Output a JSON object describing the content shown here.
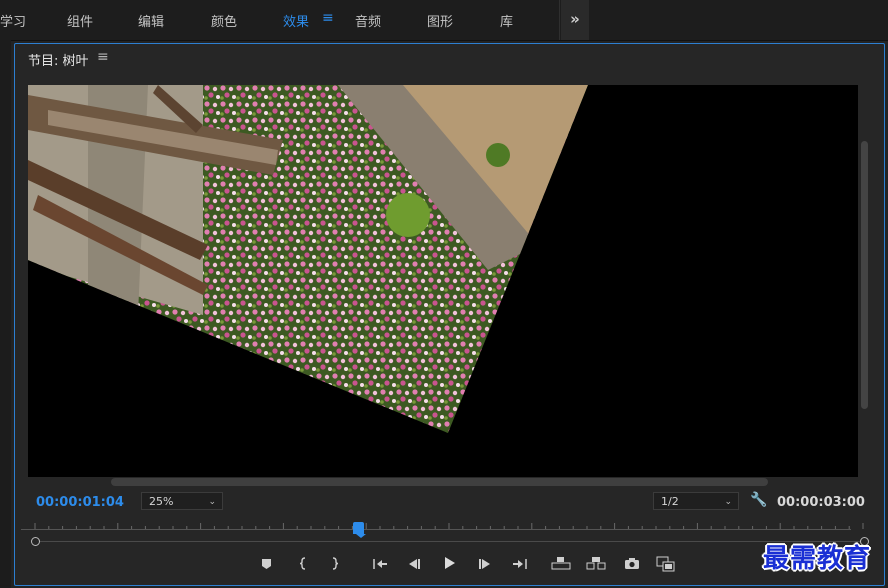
{
  "workspace_tabs": [
    "学习",
    "组件",
    "编辑",
    "颜色",
    "效果",
    "音频",
    "图形",
    "库"
  ],
  "active_tab": "效果",
  "panel": {
    "title": "节目: 树叶"
  },
  "program": {
    "current_time": "00:00:01:04",
    "duration": "00:00:03:00",
    "zoom": "25%",
    "resolution": "1/2",
    "playhead_fraction": 0.39
  },
  "controls": [
    "add-marker",
    "mark-in",
    "mark-out",
    "go-to-in",
    "step-back",
    "play",
    "step-forward",
    "go-to-out",
    "lift",
    "extract",
    "export-frame",
    "comparison-view"
  ],
  "watermark": "最需教育",
  "colors": {
    "accent": "#2d8ceb",
    "watermark": "#1a2fd4"
  }
}
